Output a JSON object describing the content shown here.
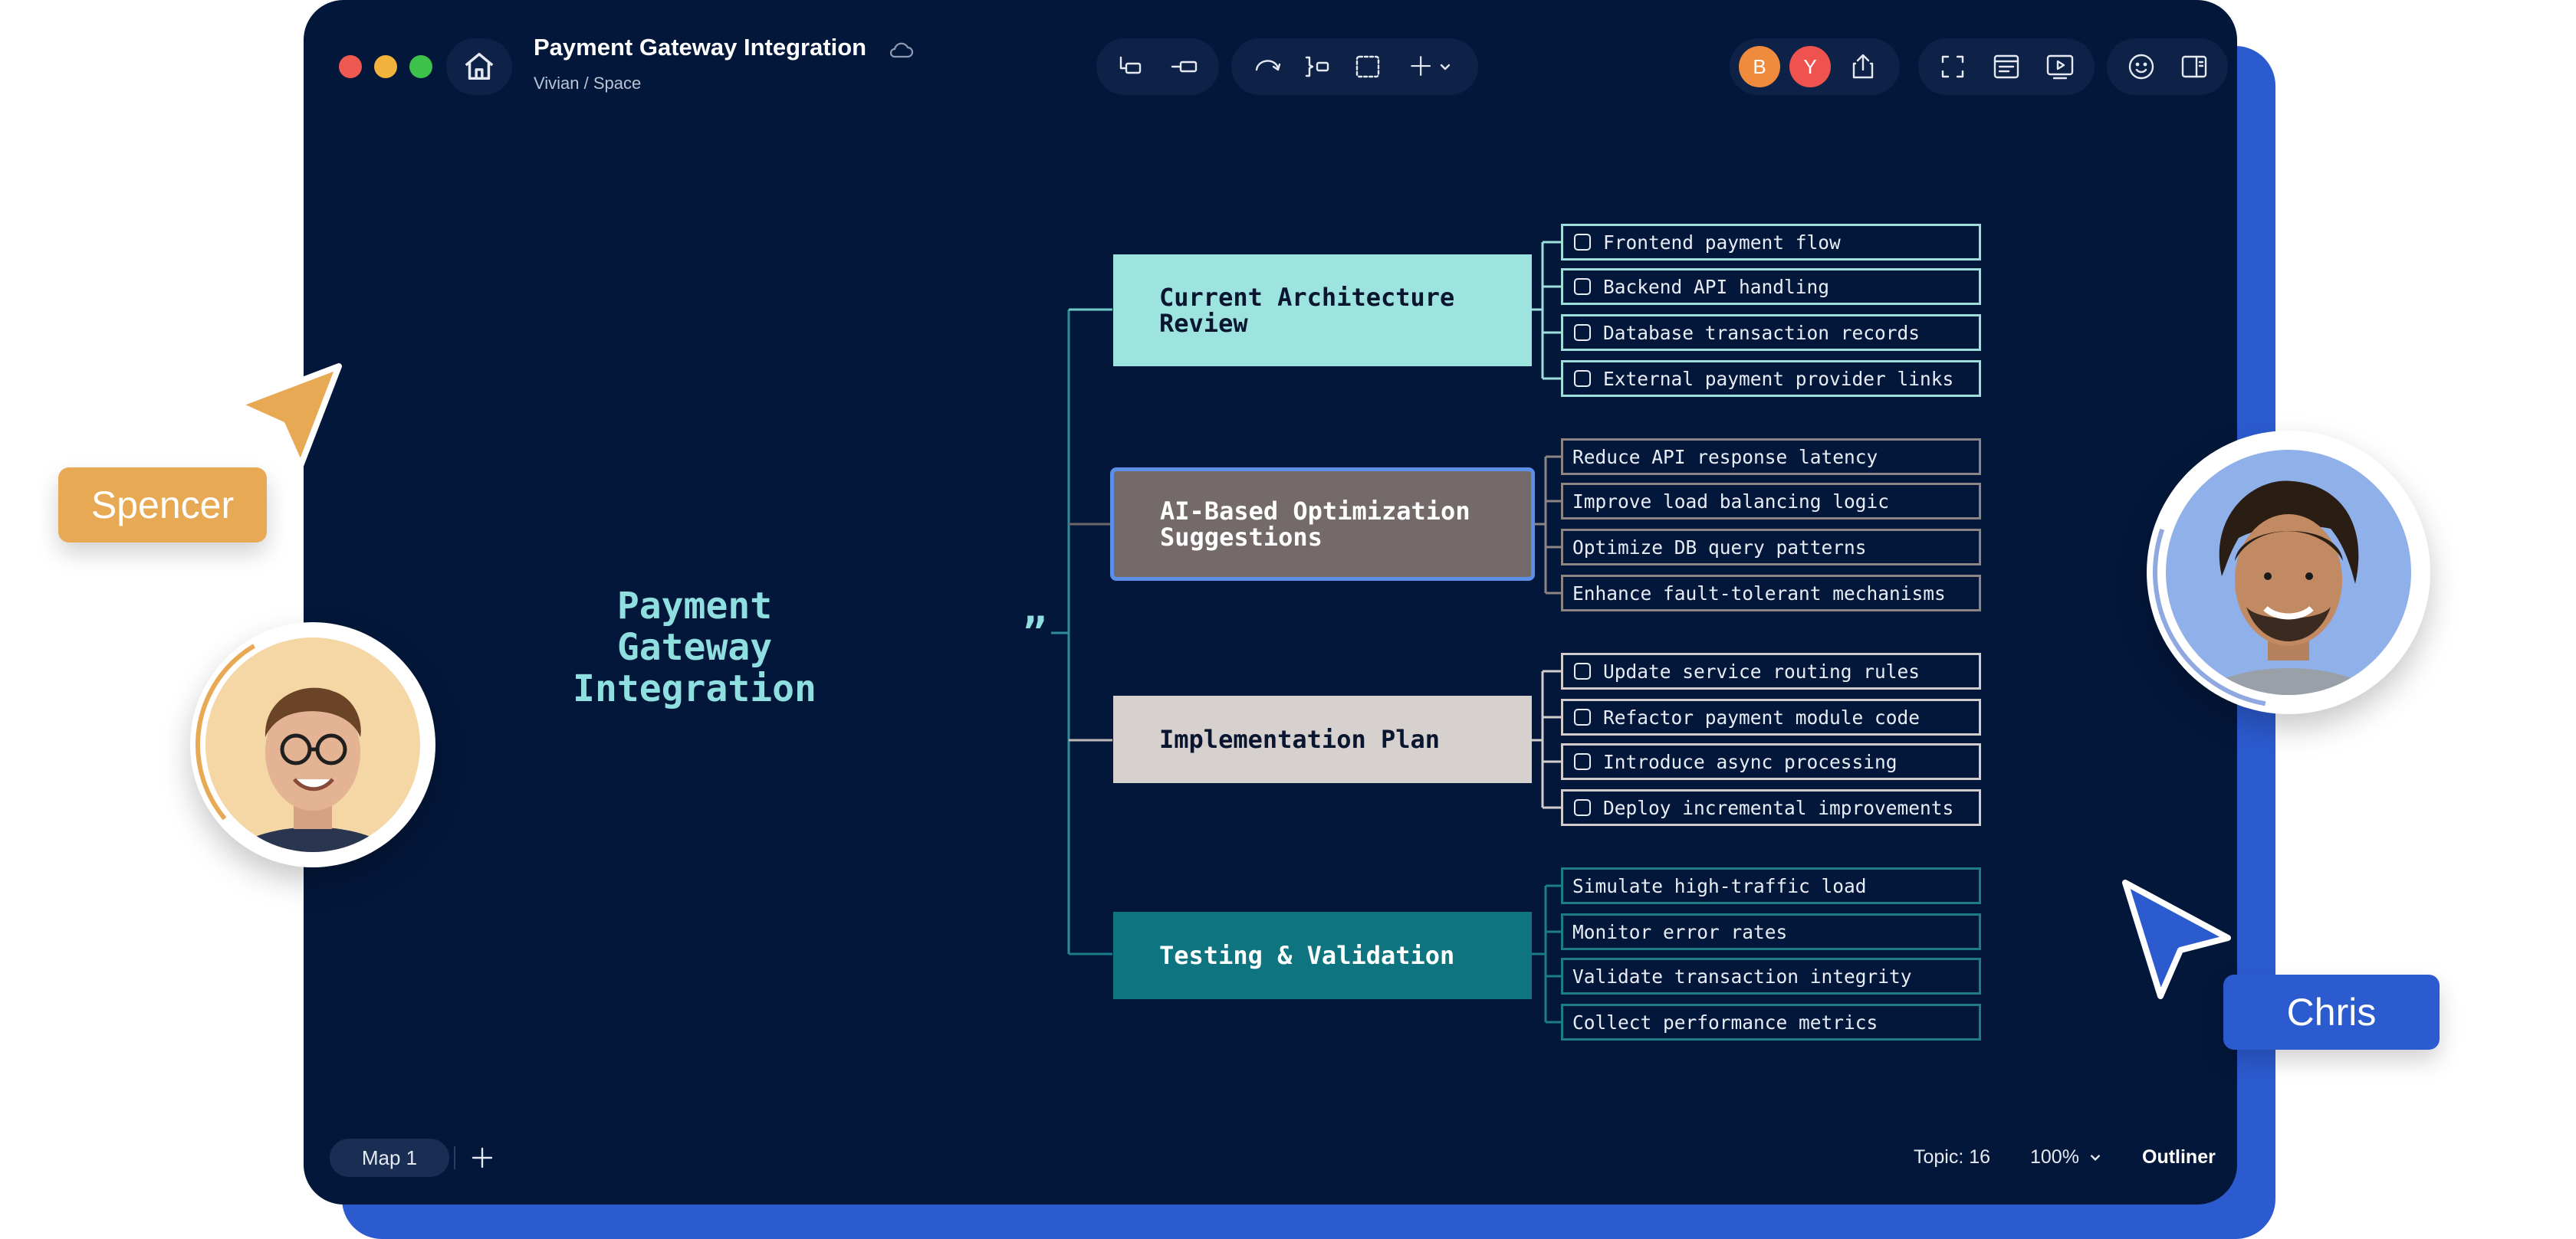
{
  "window": {
    "title": "Payment Gateway Integration",
    "breadcrumb": "Vivian / Space"
  },
  "toolbar": {
    "left_tools": [
      "insert-subtopic-icon",
      "insert-topic-icon"
    ],
    "mid_tools": [
      "relationship-icon",
      "summary-icon",
      "boundary-icon",
      "add-icon"
    ],
    "collaborators": [
      {
        "initial": "B",
        "color": "#f08a3c"
      },
      {
        "initial": "Y",
        "color": "#ef5350"
      }
    ],
    "right_tools": [
      "fullscreen-icon",
      "outline-view-icon",
      "present-icon"
    ],
    "far_tools": [
      "emoji-icon",
      "side-panel-icon"
    ]
  },
  "map": {
    "central_topic": "Payment Gateway\nIntegration",
    "branches": [
      {
        "title": "Current Architecture\nReview",
        "bg": "#9de3e0",
        "text_color": "#0a1630",
        "leaf_border": "#9fdcdc",
        "checkbox": true,
        "items": [
          "Frontend payment flow",
          "Backend API handling",
          "Database transaction records",
          "External payment provider links"
        ]
      },
      {
        "title": "AI-Based Optimization\nSuggestions",
        "bg": "#746a69",
        "text_color": "#ffffff",
        "leaf_border": "#8c8584",
        "checkbox": false,
        "items": [
          "Reduce API response latency",
          "Improve load balancing logic",
          "Optimize DB query patterns",
          "Enhance fault-tolerant mechanisms"
        ]
      },
      {
        "title": "Implementation Plan",
        "bg": "#d6d0cf",
        "text_color": "#0a1630",
        "leaf_border": "#d2cdcc",
        "checkbox": true,
        "items": [
          "Update service routing rules",
          "Refactor payment module code",
          "Introduce async processing",
          "Deploy incremental improvements"
        ]
      },
      {
        "title": "Testing & Validation",
        "bg": "#0e7480",
        "text_color": "#ffffff",
        "leaf_border": "#1c7d88",
        "checkbox": false,
        "items": [
          "Simulate high-traffic load",
          "Monitor error rates",
          "Validate transaction integrity",
          "Collect performance metrics"
        ]
      }
    ]
  },
  "footer": {
    "sheet_tab": "Map 1",
    "topic_count": "Topic: 16",
    "zoom": "100%",
    "outliner": "Outliner"
  },
  "collaborator_cursors": {
    "spencer": {
      "name": "Spencer",
      "color": "#e8a955"
    },
    "chris": {
      "name": "Chris",
      "color": "#2c5bd0"
    }
  }
}
